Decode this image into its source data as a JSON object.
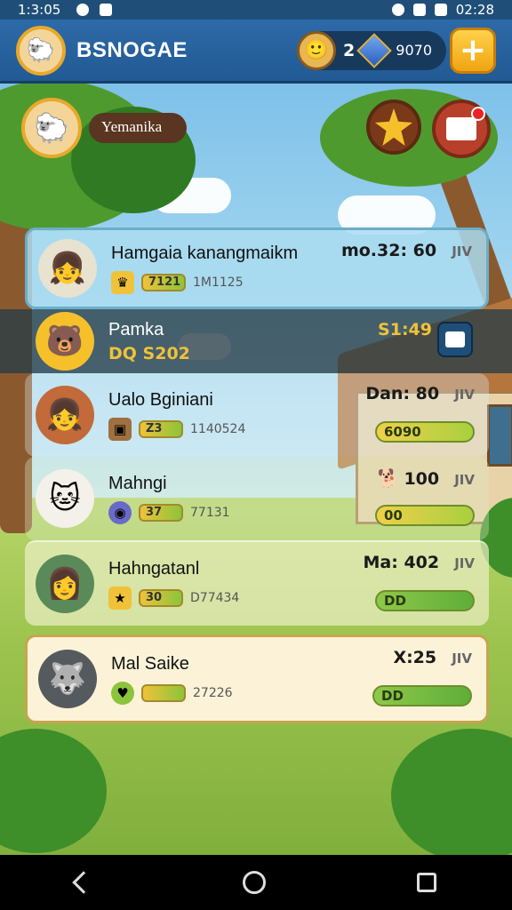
{
  "status_bar": {
    "time": "1:3:05",
    "clock": "02:28"
  },
  "header": {
    "app_title": "BSNOGAE",
    "currency_count": "2",
    "currency_amount": "9070"
  },
  "profile": {
    "name": "Yemanika"
  },
  "leaderboard": [
    {
      "name": "Hamgaia kanangmaikm",
      "score": "mo.32: 60",
      "tag": "JIV",
      "stat_bar": "7121",
      "stat_value": "1M1125",
      "avatar_icon": "girl-avatar"
    },
    {
      "name": "Pamka",
      "score": "S1:49",
      "sub": "DQ S202",
      "avatar_icon": "bear-avatar"
    },
    {
      "name": "Ualo Bginiani",
      "score": "Dan: 80",
      "tag": "JIV",
      "stat_bar": "Z3",
      "stat_value": "1140524",
      "progress": "6090",
      "avatar_icon": "girl-avatar"
    },
    {
      "name": "Mahngi",
      "score": "100",
      "tag": "JIV",
      "stat_bar": "37",
      "stat_value": "77131",
      "progress": "00",
      "avatar_icon": "cat-avatar"
    },
    {
      "name": "Hahngatanl",
      "score": "Ma: 402",
      "tag": "JIV",
      "stat_bar": "30",
      "stat_value": "D77434",
      "progress": "DD",
      "avatar_icon": "girl-avatar"
    },
    {
      "name": "Mal Saike",
      "score": "X:25",
      "tag": "JIV",
      "stat_bar": "",
      "stat_value": "27226",
      "progress": "DD",
      "avatar_icon": "wolf-avatar"
    }
  ],
  "colors": {
    "header": "#2e6aa8",
    "accent": "#f0a412",
    "highlight": "#fbf2d8"
  }
}
